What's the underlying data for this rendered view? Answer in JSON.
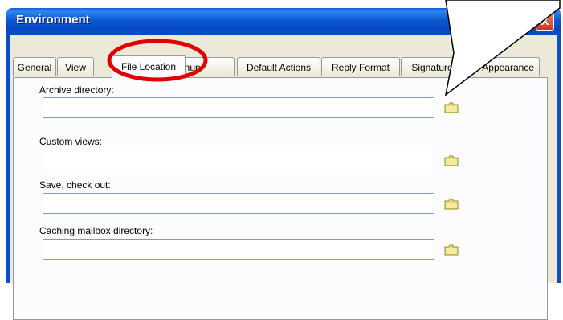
{
  "window": {
    "title": "Environment"
  },
  "titlebar_buttons": {
    "help": "?",
    "close": "X"
  },
  "tabs": [
    {
      "label": "General",
      "active": false
    },
    {
      "label": "View",
      "active": false
    },
    {
      "label": "File Location",
      "active": true
    },
    {
      "label": "Cleanup",
      "active": false
    },
    {
      "label": "Default Actions",
      "active": false
    },
    {
      "label": "Reply Format",
      "active": false
    },
    {
      "label": "Signature",
      "active": false
    },
    {
      "label": "Appearance",
      "active": false
    }
  ],
  "fields": [
    {
      "label": "Archive directory:",
      "value": ""
    },
    {
      "label": "Custom views:",
      "value": ""
    },
    {
      "label": "Save, check out:",
      "value": ""
    },
    {
      "label": "Caching mailbox directory:",
      "value": ""
    }
  ],
  "colors": {
    "highlight_circle": "#e00000",
    "title_bar": "#0b57d0",
    "folder_icon": "#e8df7a"
  }
}
